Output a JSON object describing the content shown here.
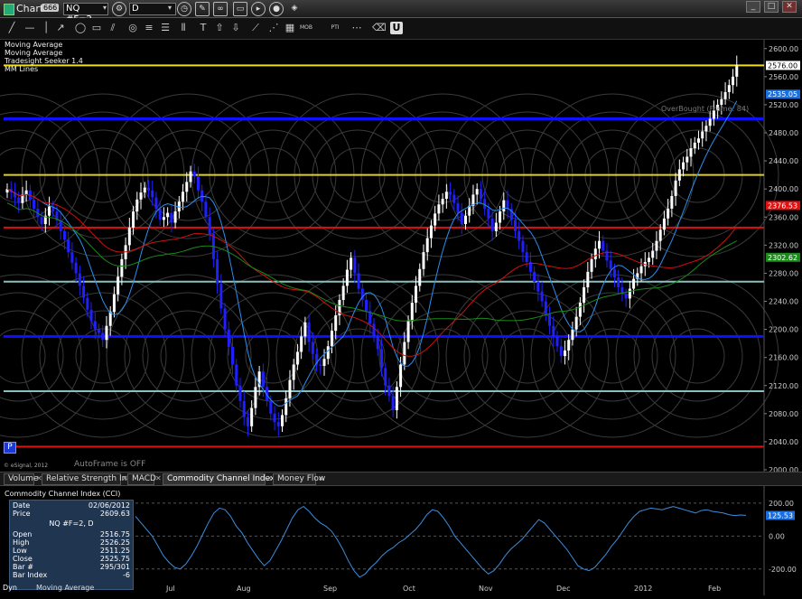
{
  "window": {
    "title": "Chart",
    "title_badge": "666",
    "symbol": "NQ #F=2",
    "interval": "D"
  },
  "toolbar_icons": [
    "cursor-icon",
    "line-icon",
    "ray-icon",
    "ellipse-icon",
    "rect-icon",
    "channel-icon",
    "circle-icon",
    "fib-icon",
    "grid-icon",
    "cycle-icon",
    "text-icon",
    "arrow-up-icon",
    "arrow-down-icon",
    "trend-icon",
    "fan-icon",
    "table-icon",
    "mob-icon",
    "pti-icon",
    "link-icon",
    "eraser-icon",
    "u-icon"
  ],
  "toolbar_labels": {
    "mob": "MOB",
    "pti": "PTI"
  },
  "studies_legend": [
    "Moving Average",
    "Moving Average",
    "Tradesight Seeker 1.4",
    "MM Lines"
  ],
  "overbought_label": "OverBought (Frame: 84)",
  "autoframe_label": "AutoFrame is OFF",
  "copyright": "© eSignal, 2012",
  "p_button": "P",
  "right_labels": [
    {
      "value": "2576.00",
      "color": "#000000",
      "bg": "#ffffff"
    },
    {
      "value": "2535.05",
      "color": "#ffffff",
      "bg": "#1a6fe0"
    },
    {
      "value": "2376.53",
      "color": "#ffffff",
      "bg": "#e01010"
    },
    {
      "value": "2302.62",
      "color": "#ffffff",
      "bg": "#1a8a1a"
    },
    {
      "value": "125.53",
      "color": "#ffffff",
      "bg": "#1a6fe0"
    }
  ],
  "tabs": [
    "Volume",
    "Relative Strength Index",
    "MACD",
    "Commodity Channel Index (CCI)",
    "Money Flow"
  ],
  "lower_study_title": "Commodity Channel Index (CCI)",
  "data_window": {
    "date_label": "Date",
    "date": "02/06/2012",
    "price_label": "Price",
    "price": "2609.63",
    "header": "NQ #F=2, D",
    "rows": [
      {
        "k": "Open",
        "v": "2516.75"
      },
      {
        "k": "High",
        "v": "2526.25"
      },
      {
        "k": "Low",
        "v": "2511.25"
      },
      {
        "k": "Close",
        "v": "2525.75"
      },
      {
        "k": "Bar #",
        "v": "295/301"
      },
      {
        "k": "Bar Index",
        "v": "-6"
      }
    ]
  },
  "footer_left": "Dyn",
  "footer_mid": "Moving Average",
  "colors": {
    "up": "#ffffff",
    "down": "#1f1fff",
    "ma_fast": "#2a8ff0",
    "ma_slow": "#d01010",
    "ma_green": "#1a8a1a",
    "cci": "#3a8ee0"
  },
  "chart_data": [
    {
      "type": "candlestick",
      "title": "NQ #F=2, D",
      "x_labels": [
        "Jul",
        "Aug",
        "Sep",
        "Oct",
        "Nov",
        "Dec",
        "2012",
        "Feb"
      ],
      "ylim": [
        2000,
        2610
      ],
      "y_ticks": [
        2000,
        2040,
        2080,
        2120,
        2160,
        2200,
        2240,
        2280,
        2320,
        2360,
        2400,
        2440,
        2480,
        2520,
        2560,
        2600
      ],
      "y_tick_labels": [
        "2000.00",
        "2040.00",
        "2080.00",
        "2120.00",
        "2160.00",
        "2200.00",
        "2240.00",
        "2280.00",
        "2320.00",
        "2360.00",
        "2400.00",
        "2440.00",
        "2480.00",
        "2520.00",
        "2560.00",
        "2600.00"
      ],
      "horizontal_levels": [
        {
          "value": 2576,
          "color": "#f0e010"
        },
        {
          "value": 2500,
          "color": "#1010ff"
        },
        {
          "value": 2420,
          "color": "#e0d020"
        },
        {
          "value": 2345,
          "color": "#e01010"
        },
        {
          "value": 2268,
          "color": "#88c0c0"
        },
        {
          "value": 2190,
          "color": "#1010ff"
        },
        {
          "value": 2112,
          "color": "#88c0c0"
        },
        {
          "value": 2033,
          "color": "#e01010"
        }
      ],
      "closes": [
        2400,
        2395,
        2388,
        2380,
        2392,
        2398,
        2385,
        2372,
        2360,
        2350,
        2362,
        2375,
        2368,
        2355,
        2340,
        2328,
        2310,
        2295,
        2280,
        2262,
        2245,
        2228,
        2212,
        2200,
        2195,
        2185,
        2205,
        2225,
        2250,
        2275,
        2300,
        2320,
        2345,
        2368,
        2385,
        2395,
        2402,
        2398,
        2388,
        2372,
        2356,
        2360,
        2366,
        2352,
        2368,
        2382,
        2396,
        2410,
        2425,
        2418,
        2398,
        2382,
        2360,
        2336,
        2300,
        2265,
        2230,
        2200,
        2175,
        2150,
        2120,
        2098,
        2075,
        2062,
        2088,
        2118,
        2140,
        2118,
        2098,
        2080,
        2068,
        2062,
        2078,
        2102,
        2128,
        2150,
        2168,
        2190,
        2210,
        2182,
        2165,
        2150,
        2148,
        2158,
        2176,
        2198,
        2220,
        2242,
        2262,
        2285,
        2302,
        2280,
        2258,
        2242,
        2226,
        2208,
        2190,
        2172,
        2145,
        2120,
        2105,
        2085,
        2118,
        2150,
        2182,
        2212,
        2238,
        2262,
        2286,
        2310,
        2330,
        2348,
        2365,
        2378,
        2386,
        2396,
        2392,
        2380,
        2366,
        2350,
        2362,
        2376,
        2392,
        2400,
        2386,
        2372,
        2358,
        2340,
        2352,
        2368,
        2384,
        2372,
        2356,
        2340,
        2326,
        2310,
        2296,
        2282,
        2268,
        2254,
        2240,
        2222,
        2205,
        2190,
        2176,
        2162,
        2170,
        2185,
        2200,
        2218,
        2238,
        2260,
        2282,
        2300,
        2315,
        2326,
        2312,
        2298,
        2286,
        2274,
        2260,
        2250,
        2244,
        2258,
        2272,
        2280,
        2290,
        2296,
        2302,
        2312,
        2326,
        2342,
        2358,
        2372,
        2390,
        2412,
        2428,
        2438,
        2446,
        2458,
        2466,
        2472,
        2482,
        2490,
        2500,
        2512,
        2520,
        2528,
        2538,
        2548,
        2560,
        2576
      ]
    },
    {
      "type": "line",
      "title": "Commodity Channel Index (CCI)",
      "ylim": [
        -300,
        260
      ],
      "y_ticks": [
        200,
        0,
        -200
      ],
      "y_tick_labels": [
        "200.00",
        "0.00",
        "-200.00"
      ],
      "last_value": 125.53,
      "values": [
        120,
        80,
        40,
        0,
        -60,
        -120,
        -160,
        -190,
        -200,
        -170,
        -120,
        -60,
        10,
        80,
        140,
        170,
        160,
        120,
        60,
        20,
        -40,
        -90,
        -140,
        -180,
        -150,
        -90,
        -30,
        40,
        110,
        160,
        180,
        150,
        110,
        80,
        60,
        30,
        -20,
        -80,
        -150,
        -210,
        -250,
        -230,
        -190,
        -160,
        -120,
        -90,
        -70,
        -40,
        -20,
        10,
        40,
        80,
        130,
        160,
        150,
        110,
        60,
        0,
        -40,
        -80,
        -120,
        -160,
        -200,
        -230,
        -210,
        -170,
        -120,
        -80,
        -50,
        -20,
        20,
        60,
        100,
        80,
        40,
        0,
        -40,
        -80,
        -130,
        -180,
        -200,
        -210,
        -190,
        -150,
        -110,
        -60,
        -20,
        30,
        80,
        120,
        150,
        160,
        170,
        165,
        160,
        170,
        180,
        170,
        160,
        150,
        140,
        155,
        160,
        150,
        145,
        140,
        130,
        125,
        128,
        126
      ]
    }
  ]
}
